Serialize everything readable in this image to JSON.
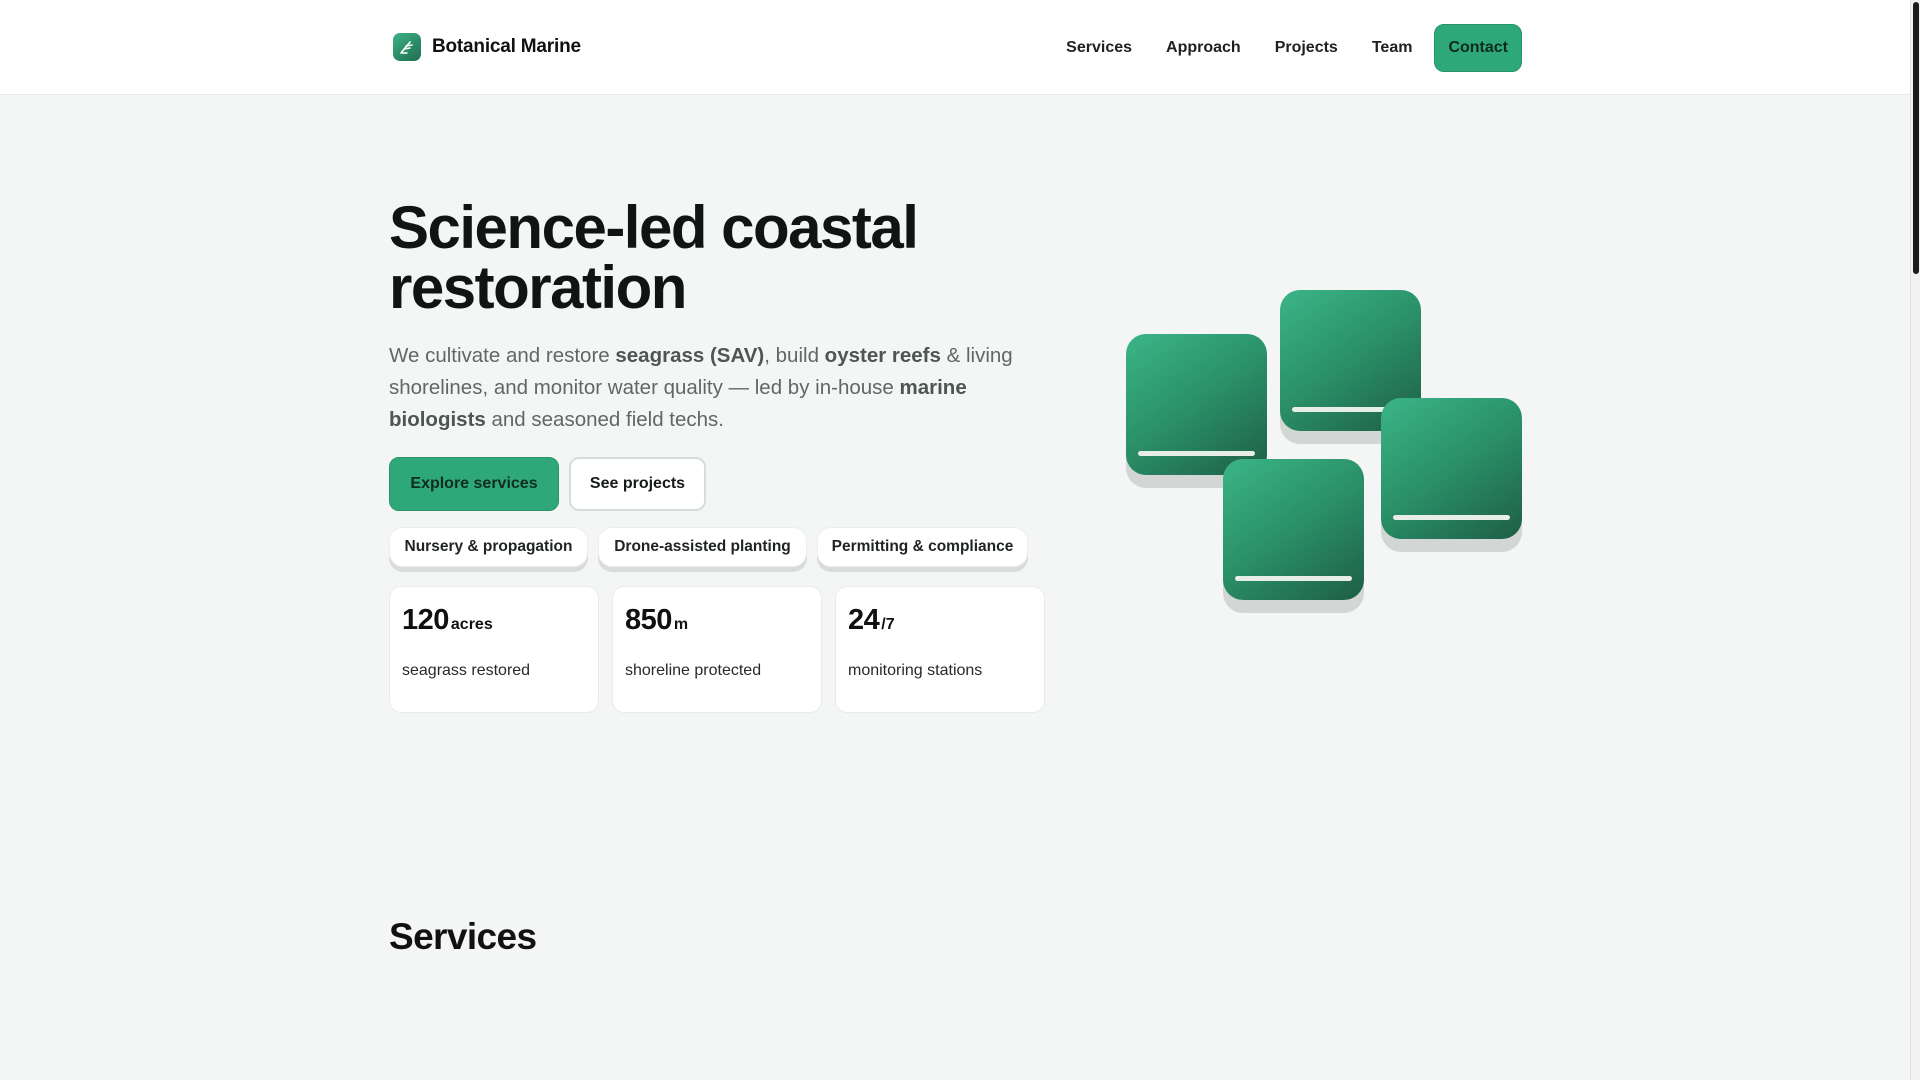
{
  "header": {
    "brand_name": "Botanical Marine",
    "brand_icon": "leaf-icon",
    "nav": [
      "Services",
      "Approach",
      "Projects",
      "Team"
    ],
    "contact_label": "Contact"
  },
  "hero": {
    "title": "Science-led coastal restoration",
    "lead": {
      "t1": "We cultivate and restore ",
      "b1": "seagrass (SAV)",
      "t2": ", build ",
      "b2": "oyster reefs",
      "t3": " & living shorelines, and monitor water quality — led by in-house ",
      "b3": "marine biologists",
      "t4": " and seasoned field techs."
    },
    "primary_button": "Explore services",
    "secondary_button": "See projects",
    "chips": [
      "Nursery & propagation",
      "Drone-assisted planting",
      "Permitting & compliance"
    ],
    "stats": [
      {
        "value": "120",
        "unit": "acres",
        "label": "seagrass restored"
      },
      {
        "value": "850",
        "unit": "m",
        "label": "shoreline protected"
      },
      {
        "value": "24",
        "unit": "/7",
        "label": "monitoring stations"
      }
    ]
  },
  "colors": {
    "accent": "#2fa879",
    "background": "#f4f6f5",
    "tile_gradient_start": "#3bb587",
    "tile_gradient_end": "#1e5e46"
  },
  "services": {
    "title": "Services"
  }
}
